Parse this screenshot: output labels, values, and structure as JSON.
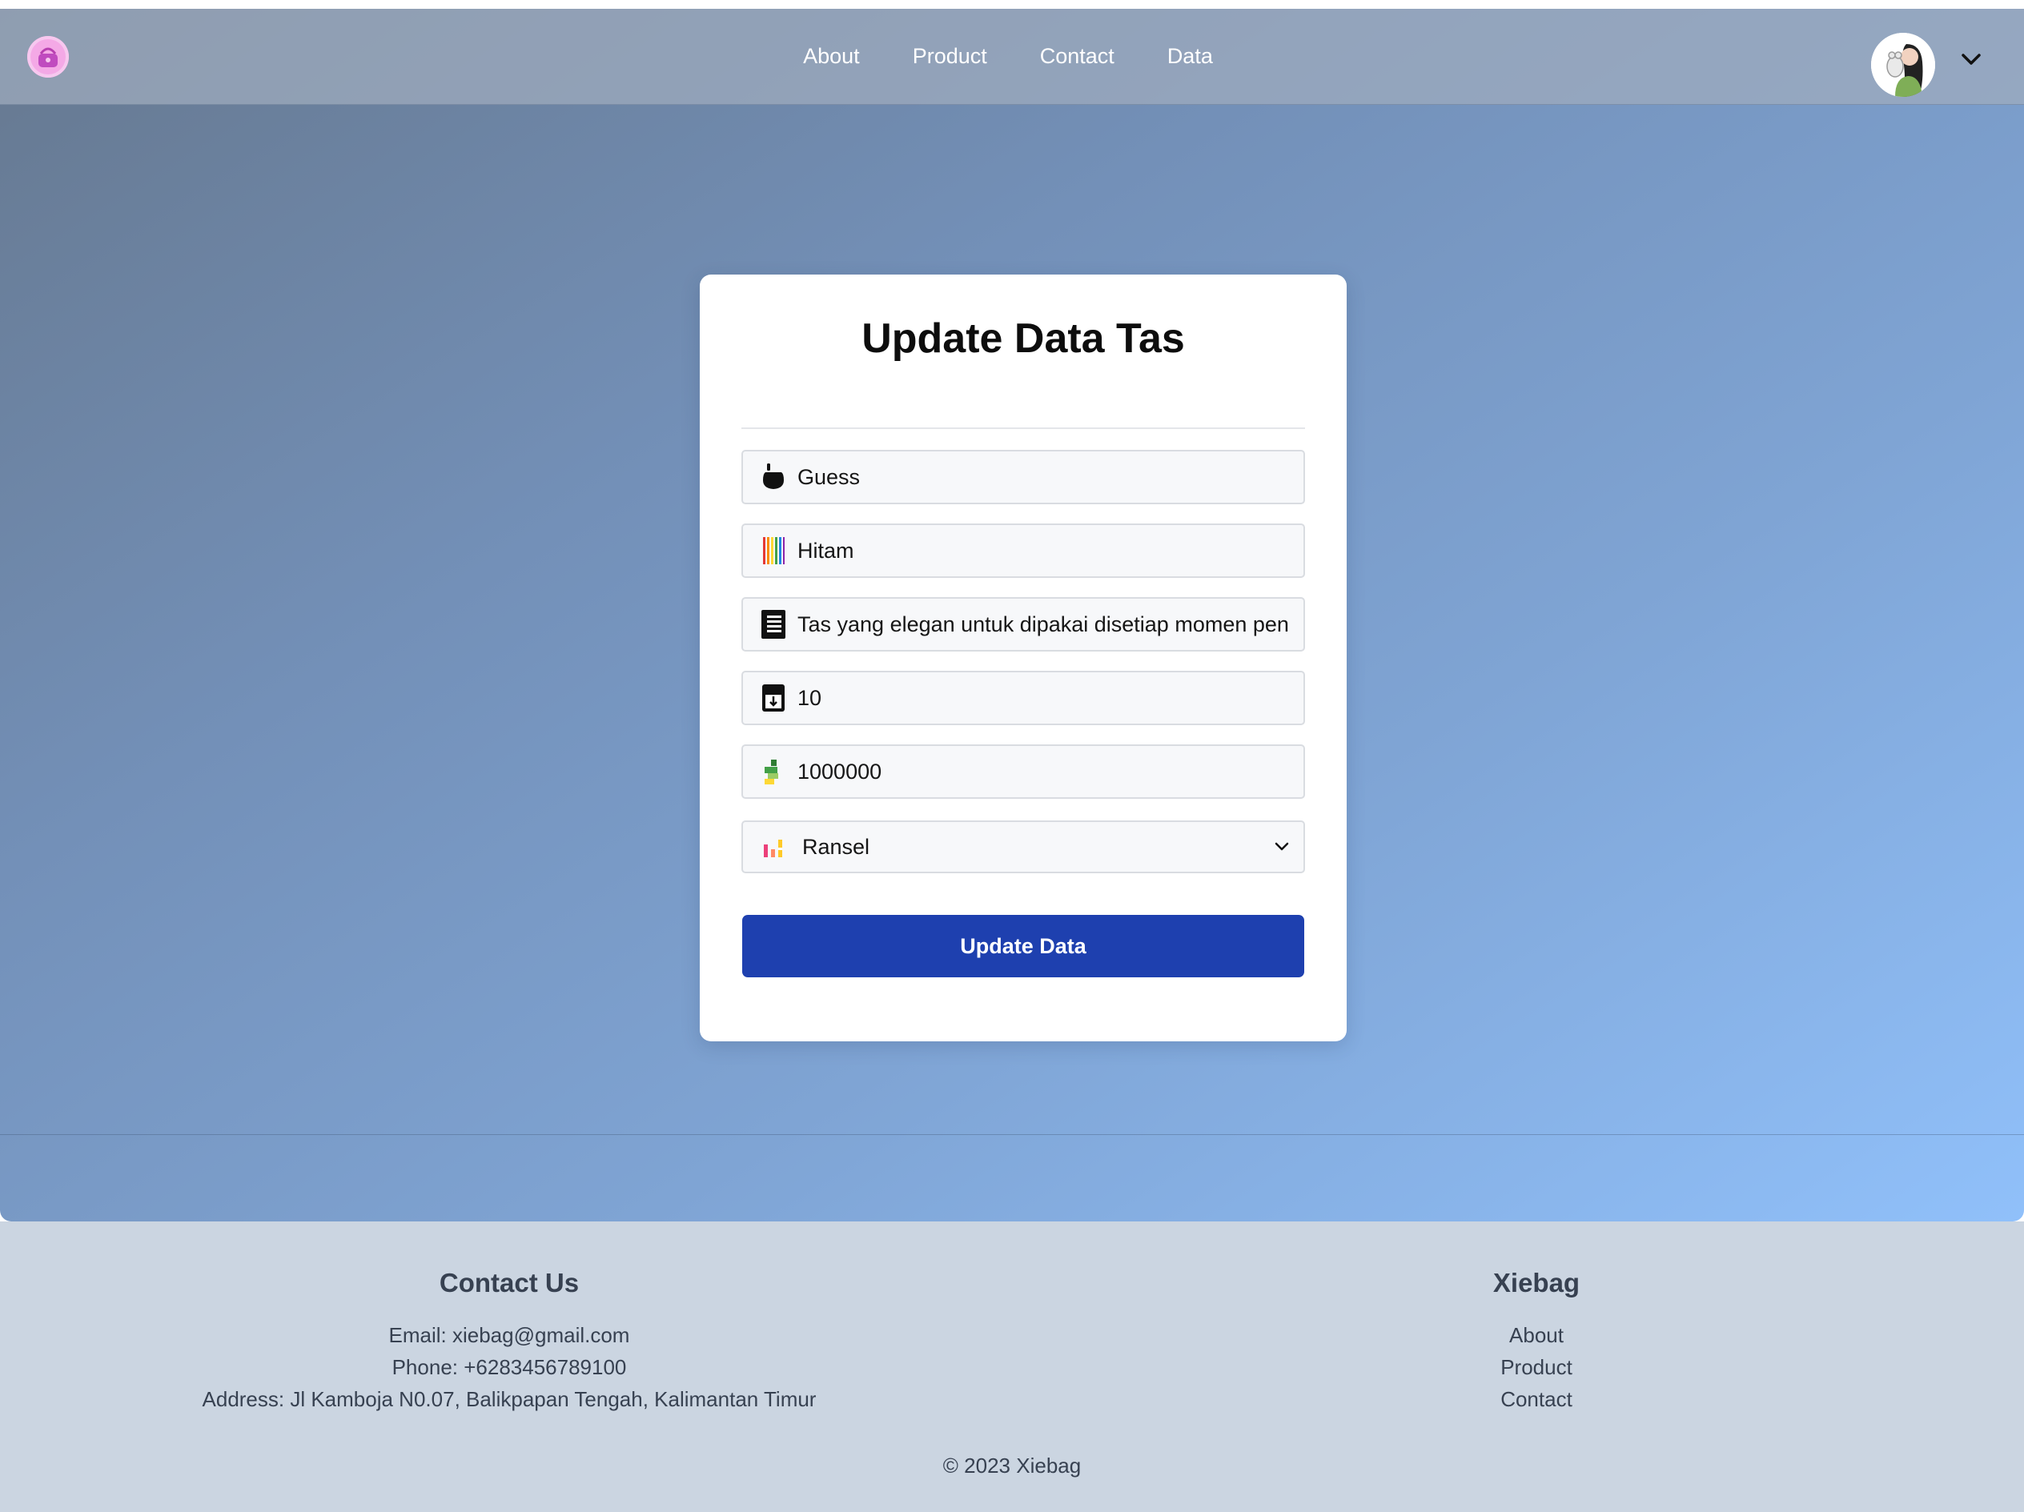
{
  "nav": {
    "links": [
      "About",
      "Product",
      "Contact",
      "Data"
    ]
  },
  "form": {
    "title": "Update Data Tas",
    "fields": {
      "brand": "Guess",
      "color": "Hitam",
      "description": "Tas yang elegan untuk dipakai disetiap momen pen",
      "stock": "10",
      "price": "1000000"
    },
    "category_selected": "Ransel",
    "submit_label": "Update Data"
  },
  "footer": {
    "contact_title": "Contact Us",
    "email": "Email: xiebag@gmail.com",
    "phone": "Phone: +6283456789100",
    "address": "Address: Jl Kamboja N0.07, Balikpapan Tengah, Kalimantan Timur",
    "brand_title": "Xiebag",
    "links": [
      "About",
      "Product",
      "Contact"
    ],
    "copyright": "© 2023 Xiebag"
  },
  "colors": {
    "primary_button": "#1e40af",
    "footer_bg": "#cbd5e1",
    "logo_pink": "#f4a9e6"
  }
}
